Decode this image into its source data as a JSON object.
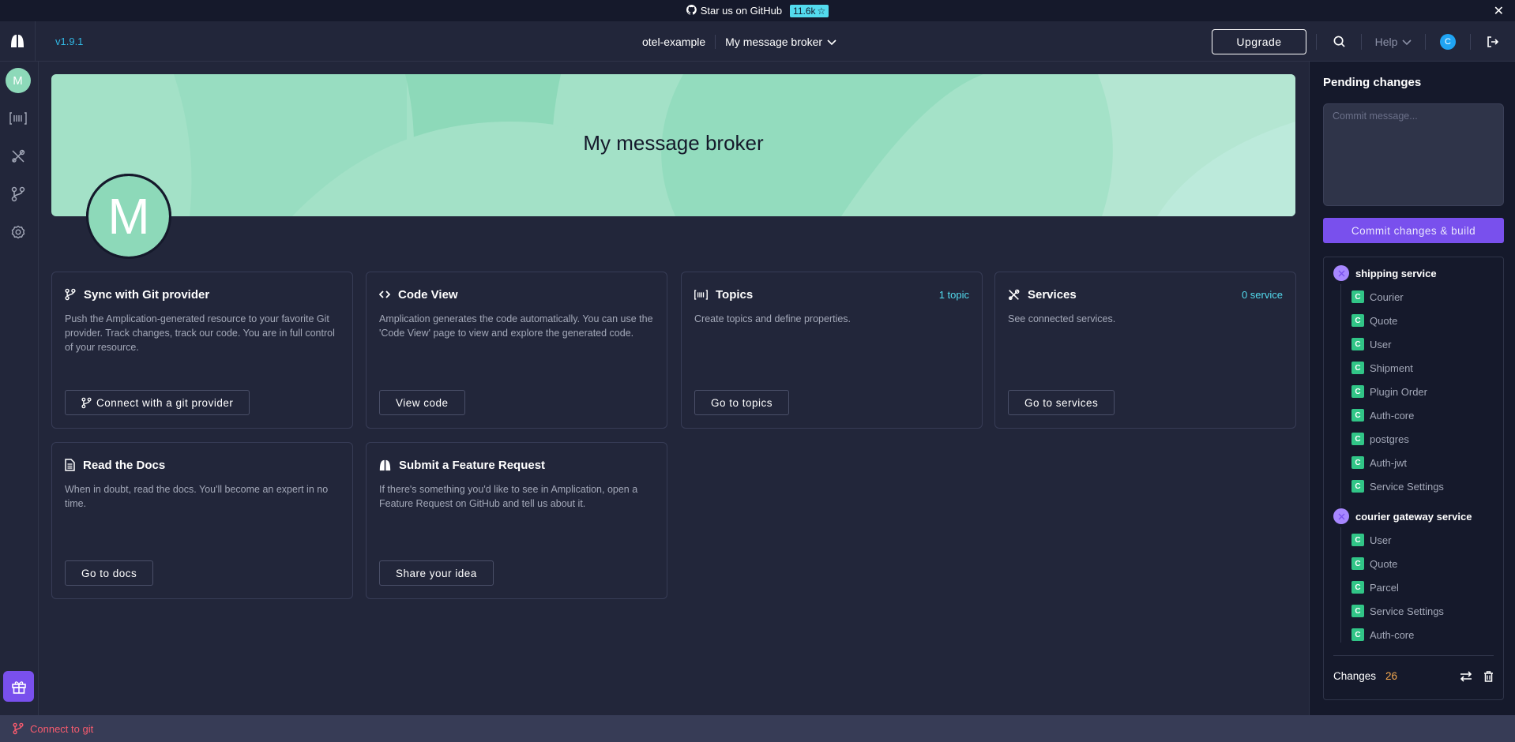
{
  "promo": {
    "github_label": "Star us on GitHub",
    "stars": "11.6k",
    "icon_github": "github-icon",
    "icon_star": "star-icon",
    "icon_close": "close-icon"
  },
  "header": {
    "version": "v1.9.1",
    "workspace": "otel-example",
    "resource": "My message broker",
    "upgrade_label": "Upgrade",
    "help_label": "Help",
    "user_initial": "C"
  },
  "rail": {
    "avatar_initial": "M",
    "items": [
      {
        "icon": "topics-icon",
        "label": "Topics"
      },
      {
        "icon": "services-icon",
        "label": "Services"
      },
      {
        "icon": "git-branch-icon",
        "label": "Sync with Git"
      },
      {
        "icon": "settings-icon",
        "label": "Settings"
      }
    ]
  },
  "hero": {
    "title": "My message broker",
    "avatar_initial": "M"
  },
  "cards": [
    {
      "icon": "git-branch-icon",
      "title": "Sync with Git provider",
      "count": "",
      "description": "Push the Amplication-generated resource to your favorite Git provider. Track changes, track our code. You are in full control of your resource.",
      "button": "Connect with a git provider"
    },
    {
      "icon": "code-icon",
      "title": "Code View",
      "count": "",
      "description": "Amplication generates the code automatically. You can use the 'Code View' page to view and explore the generated code.",
      "button": "View code"
    },
    {
      "icon": "topics-icon",
      "title": "Topics",
      "count": "1 topic",
      "description": "Create topics and define properties.",
      "button": "Go to topics"
    },
    {
      "icon": "services-icon",
      "title": "Services",
      "count": "0 service",
      "description": "See connected services.",
      "button": "Go to services"
    },
    {
      "icon": "document-icon",
      "title": "Read the Docs",
      "count": "",
      "description": "When in doubt, read the docs. You'll become an expert in no time.",
      "button": "Go to docs"
    },
    {
      "icon": "amplication-logo-icon",
      "title": "Submit a Feature Request",
      "count": "",
      "description": "If there's something you'd like to see in Amplication, open a Feature Request on GitHub and tell us about it.",
      "button": "Share your idea"
    }
  ],
  "pending": {
    "title": "Pending changes",
    "commit_placeholder": "Commit message...",
    "commit_value": "",
    "commit_button": "Commit changes & build",
    "services": [
      {
        "name": "shipping service",
        "changes": [
          "Courier",
          "Quote",
          "User",
          "Shipment",
          "Plugin Order",
          "Auth-core",
          "postgres",
          "Auth-jwt",
          "Service Settings"
        ]
      },
      {
        "name": "courier gateway service",
        "changes": [
          "User",
          "Quote",
          "Parcel",
          "Service Settings",
          "Auth-core"
        ]
      }
    ],
    "change_badge": "C",
    "changes_label": "Changes",
    "changes_count": "26"
  },
  "bottom": {
    "connect_label": "Connect to git"
  },
  "colors": {
    "accent_purple": "#7950ed",
    "accent_cyan": "#53dbee",
    "change_green": "#31c587",
    "error_red": "#f85b6e",
    "count_orange": "#f6aa50",
    "hero_green": "#8dd9b9"
  }
}
